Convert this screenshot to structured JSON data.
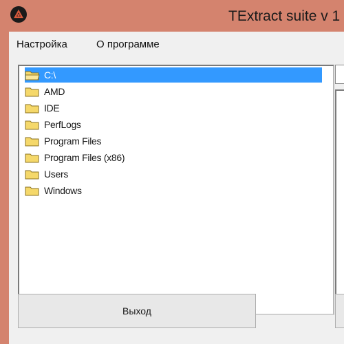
{
  "window": {
    "title": "TExtract suite v 1",
    "app_icon": "bug-icon"
  },
  "menu": [
    {
      "label": "Настройка"
    },
    {
      "label": "О программе"
    }
  ],
  "tree": {
    "items": [
      {
        "label": "C:\\",
        "selected": true,
        "icon": "open-folder-icon"
      },
      {
        "label": "AMD",
        "selected": false,
        "icon": "folder-icon"
      },
      {
        "label": "IDE",
        "selected": false,
        "icon": "folder-icon"
      },
      {
        "label": "PerfLogs",
        "selected": false,
        "icon": "folder-icon"
      },
      {
        "label": "Program Files",
        "selected": false,
        "icon": "folder-icon"
      },
      {
        "label": "Program Files (x86)",
        "selected": false,
        "icon": "folder-icon"
      },
      {
        "label": "Users",
        "selected": false,
        "icon": "folder-icon"
      },
      {
        "label": "Windows",
        "selected": false,
        "icon": "folder-icon"
      }
    ]
  },
  "buttons": {
    "exit_label": "Выход"
  },
  "colors": {
    "frame": "#d4836e",
    "selection": "#3399ff",
    "folder": "#f5d86a"
  }
}
